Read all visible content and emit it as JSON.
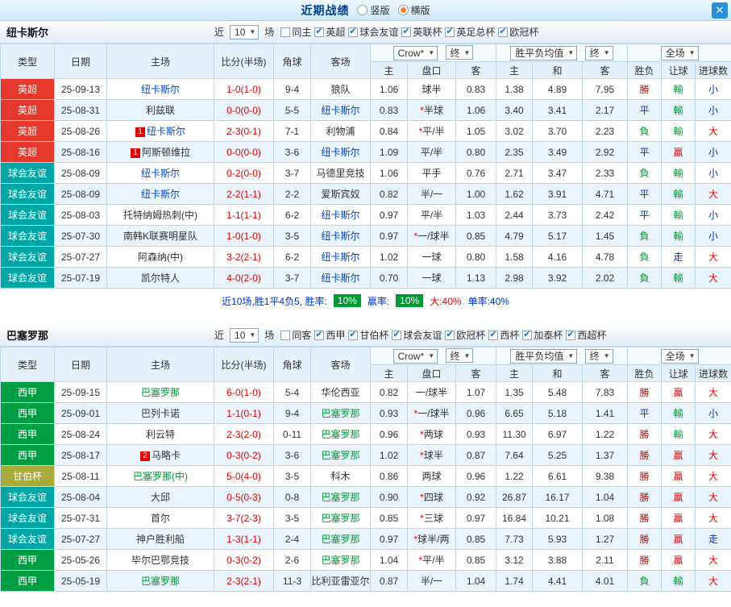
{
  "topbar": {
    "title": "近期战绩",
    "layout_options": [
      {
        "label": "竖版",
        "selected": false
      },
      {
        "label": "横版",
        "selected": true
      }
    ],
    "close_icon": "✕"
  },
  "type_colors": {
    "英超": "#e6392e",
    "球会友谊": "#00a6a6",
    "西甲": "#009e44",
    "甘伯杯": "#a8aa3c"
  },
  "result_colors": {
    "勝": "#e60000",
    "贏": "#e60000",
    "大": "#e60000",
    "平": "#0033cc",
    "走": "#0033cc",
    "小": "#0033cc",
    "負": "#009933",
    "輸": "#009933"
  },
  "sections": [
    {
      "team": "纽卡斯尔",
      "focal_color": "#0044cc",
      "near_label": "近",
      "near_count": "10",
      "near_suffix": "场",
      "filters": [
        {
          "label": "同主",
          "checked": false
        },
        {
          "label": "英超",
          "checked": true
        },
        {
          "label": "球会友谊",
          "checked": true
        },
        {
          "label": "英联杯",
          "checked": true
        },
        {
          "label": "英足总杯",
          "checked": true
        },
        {
          "label": "欧冠杯",
          "checked": true
        }
      ],
      "columns": {
        "type": "类型",
        "date": "日期",
        "home": "主场",
        "score": "比分(半场)",
        "corner": "角球",
        "away": "客场"
      },
      "odds_select": "Crow*",
      "odds_final": "终",
      "avg_select": "胜平负均值",
      "avg_final": "终",
      "scope_select": "全场",
      "sub_headers": [
        "主",
        "盘口",
        "客",
        "主",
        "和",
        "客",
        "胜负",
        "让球",
        "进球数"
      ],
      "rows": [
        {
          "type": "英超",
          "date": "25-09-13",
          "home": "纽卡斯尔",
          "home_focal": true,
          "home_badge": "",
          "score": "1-0(1-0)",
          "corner": "9-4",
          "away": "狼队",
          "away_focal": false,
          "away_badge": "",
          "odds_home": "1.06",
          "handicap": "球半",
          "odds_away": "0.83",
          "avg_home": "1.38",
          "avg_draw": "4.89",
          "avg_away": "7.95",
          "res_outcome": "勝",
          "res_handicap": "輸",
          "res_goals": "小"
        },
        {
          "type": "英超",
          "date": "25-08-31",
          "home": "利兹联",
          "home_focal": false,
          "home_badge": "",
          "score": "0-0(0-0)",
          "corner": "5-5",
          "away": "纽卡斯尔",
          "away_focal": true,
          "away_badge": "",
          "odds_home": "0.83",
          "handicap": "*半球",
          "odds_away": "1.06",
          "avg_home": "3.40",
          "avg_draw": "3.41",
          "avg_away": "2.17",
          "res_outcome": "平",
          "res_handicap": "輸",
          "res_goals": "小"
        },
        {
          "type": "英超",
          "date": "25-08-26",
          "home": "纽卡斯尔",
          "home_focal": true,
          "home_badge": "1",
          "score": "2-3(0-1)",
          "corner": "7-1",
          "away": "利物浦",
          "away_focal": false,
          "away_badge": "",
          "odds_home": "0.84",
          "handicap": "*平/半",
          "odds_away": "1.05",
          "avg_home": "3.02",
          "avg_draw": "3.70",
          "avg_away": "2.23",
          "res_outcome": "負",
          "res_handicap": "輸",
          "res_goals": "大"
        },
        {
          "type": "英超",
          "date": "25-08-16",
          "home": "阿斯顿维拉",
          "home_focal": false,
          "home_badge": "1",
          "score": "0-0(0-0)",
          "corner": "3-6",
          "away": "纽卡斯尔",
          "away_focal": true,
          "away_badge": "",
          "odds_home": "1.09",
          "handicap": "平/半",
          "odds_away": "0.80",
          "avg_home": "2.35",
          "avg_draw": "3.49",
          "avg_away": "2.92",
          "res_outcome": "平",
          "res_handicap": "贏",
          "res_goals": "小"
        },
        {
          "type": "球会友谊",
          "date": "25-08-09",
          "home": "纽卡斯尔",
          "home_focal": true,
          "home_badge": "",
          "score": "0-2(0-0)",
          "corner": "3-7",
          "away": "马德里竞技",
          "away_focal": false,
          "away_badge": "",
          "odds_home": "1.06",
          "handicap": "平手",
          "odds_away": "0.76",
          "avg_home": "2.71",
          "avg_draw": "3.47",
          "avg_away": "2.33",
          "res_outcome": "負",
          "res_handicap": "輸",
          "res_goals": "小"
        },
        {
          "type": "球会友谊",
          "date": "25-08-09",
          "home": "纽卡斯尔",
          "home_focal": true,
          "home_badge": "",
          "score": "2-2(1-1)",
          "corner": "2-2",
          "away": "爱斯宾奴",
          "away_focal": false,
          "away_badge": "",
          "odds_home": "0.82",
          "handicap": "半/一",
          "odds_away": "1.00",
          "avg_home": "1.62",
          "avg_draw": "3.91",
          "avg_away": "4.71",
          "res_outcome": "平",
          "res_handicap": "輸",
          "res_goals": "大"
        },
        {
          "type": "球会友谊",
          "date": "25-08-03",
          "home": "托特纳姆热刺(中)",
          "home_focal": false,
          "home_badge": "",
          "score": "1-1(1-1)",
          "corner": "6-2",
          "away": "纽卡斯尔",
          "away_focal": true,
          "away_badge": "",
          "odds_home": "0.97",
          "handicap": "平/半",
          "odds_away": "1.03",
          "avg_home": "2.44",
          "avg_draw": "3.73",
          "avg_away": "2.42",
          "res_outcome": "平",
          "res_handicap": "輸",
          "res_goals": "小"
        },
        {
          "type": "球会友谊",
          "date": "25-07-30",
          "home": "南韩K联赛明星队",
          "home_focal": false,
          "home_badge": "",
          "score": "1-0(1-0)",
          "corner": "3-5",
          "away": "纽卡斯尔",
          "away_focal": true,
          "away_badge": "",
          "odds_home": "0.97",
          "handicap": "*一/球半",
          "odds_away": "0.85",
          "avg_home": "4.79",
          "avg_draw": "5.17",
          "avg_away": "1.45",
          "res_outcome": "負",
          "res_handicap": "輸",
          "res_goals": "小"
        },
        {
          "type": "球会友谊",
          "date": "25-07-27",
          "home": "阿森纳(中)",
          "home_focal": false,
          "home_badge": "",
          "score": "3-2(2-1)",
          "corner": "6-2",
          "away": "纽卡斯尔",
          "away_focal": true,
          "away_badge": "",
          "odds_home": "1.02",
          "handicap": "一球",
          "odds_away": "0.80",
          "avg_home": "1.58",
          "avg_draw": "4.16",
          "avg_away": "4.78",
          "res_outcome": "負",
          "res_handicap": "走",
          "res_goals": "大"
        },
        {
          "type": "球会友谊",
          "date": "25-07-19",
          "home": "凯尔特人",
          "home_focal": false,
          "home_badge": "",
          "score": "4-0(2-0)",
          "corner": "3-7",
          "away": "纽卡斯尔",
          "away_focal": true,
          "away_badge": "",
          "odds_home": "0.70",
          "handicap": "一球",
          "odds_away": "1.13",
          "avg_home": "2.98",
          "avg_draw": "3.92",
          "avg_away": "2.02",
          "res_outcome": "負",
          "res_handicap": "輸",
          "res_goals": "大"
        }
      ],
      "summary": {
        "lead": "近10场,胜1平4负5, 胜率:",
        "win_rate": "10%",
        "mid": "赢率:",
        "odds_rate": "10%",
        "big": "大:40%",
        "single": "单率:40%"
      }
    },
    {
      "team": "巴塞罗那",
      "focal_color": "#009933",
      "near_label": "近",
      "near_count": "10",
      "near_suffix": "场",
      "filters": [
        {
          "label": "同客",
          "checked": false
        },
        {
          "label": "西甲",
          "checked": true
        },
        {
          "label": "甘伯杯",
          "checked": true
        },
        {
          "label": "球会友谊",
          "checked": true
        },
        {
          "label": "欧冠杯",
          "checked": true
        },
        {
          "label": "西杯",
          "checked": true
        },
        {
          "label": "加泰杯",
          "checked": true
        },
        {
          "label": "西超杯",
          "checked": true
        }
      ],
      "columns": {
        "type": "类型",
        "date": "日期",
        "home": "主场",
        "score": "比分(半场)",
        "corner": "角球",
        "away": "客场"
      },
      "odds_select": "Crow*",
      "odds_final": "终",
      "avg_select": "胜平负均值",
      "avg_final": "终",
      "scope_select": "全场",
      "sub_headers": [
        "主",
        "盘口",
        "客",
        "主",
        "和",
        "客",
        "胜负",
        "让球",
        "进球数"
      ],
      "rows": [
        {
          "type": "西甲",
          "date": "25-09-15",
          "home": "巴塞罗那",
          "home_focal": true,
          "home_badge": "",
          "score": "6-0(1-0)",
          "corner": "5-4",
          "away": "华伦西亚",
          "away_focal": false,
          "away_badge": "",
          "odds_home": "0.82",
          "handicap": "一/球半",
          "odds_away": "1.07",
          "avg_home": "1.35",
          "avg_draw": "5.48",
          "avg_away": "7.83",
          "res_outcome": "勝",
          "res_handicap": "贏",
          "res_goals": "大"
        },
        {
          "type": "西甲",
          "date": "25-09-01",
          "home": "巴列卡诺",
          "home_focal": false,
          "home_badge": "",
          "score": "1-1(0-1)",
          "corner": "9-4",
          "away": "巴塞罗那",
          "away_focal": true,
          "away_badge": "",
          "odds_home": "0.93",
          "handicap": "*一/球半",
          "odds_away": "0.96",
          "avg_home": "6.65",
          "avg_draw": "5.18",
          "avg_away": "1.41",
          "res_outcome": "平",
          "res_handicap": "輸",
          "res_goals": "小"
        },
        {
          "type": "西甲",
          "date": "25-08-24",
          "home": "利云特",
          "home_focal": false,
          "home_badge": "",
          "score": "2-3(2-0)",
          "corner": "0-11",
          "away": "巴塞罗那",
          "away_focal": true,
          "away_badge": "",
          "odds_home": "0.96",
          "handicap": "*两球",
          "odds_away": "0.93",
          "avg_home": "11.30",
          "avg_draw": "6.97",
          "avg_away": "1.22",
          "res_outcome": "勝",
          "res_handicap": "輸",
          "res_goals": "大"
        },
        {
          "type": "西甲",
          "date": "25-08-17",
          "home": "马略卡",
          "home_focal": false,
          "home_badge": "2",
          "score": "0-3(0-2)",
          "corner": "3-6",
          "away": "巴塞罗那",
          "away_focal": true,
          "away_badge": "",
          "odds_home": "1.02",
          "handicap": "*球半",
          "odds_away": "0.87",
          "avg_home": "7.64",
          "avg_draw": "5.25",
          "avg_away": "1.37",
          "res_outcome": "勝",
          "res_handicap": "贏",
          "res_goals": "大"
        },
        {
          "type": "甘伯杯",
          "date": "25-08-11",
          "home": "巴塞罗那(中)",
          "home_focal": true,
          "home_badge": "",
          "score": "5-0(4-0)",
          "corner": "3-5",
          "away": "科木",
          "away_focal": false,
          "away_badge": "",
          "odds_home": "0.86",
          "handicap": "两球",
          "odds_away": "0.96",
          "avg_home": "1.22",
          "avg_draw": "6.61",
          "avg_away": "9.38",
          "res_outcome": "勝",
          "res_handicap": "贏",
          "res_goals": "大"
        },
        {
          "type": "球会友谊",
          "date": "25-08-04",
          "home": "大邱",
          "home_focal": false,
          "home_badge": "",
          "score": "0-5(0-3)",
          "corner": "0-8",
          "away": "巴塞罗那",
          "away_focal": true,
          "away_badge": "",
          "odds_home": "0.90",
          "handicap": "*四球",
          "odds_away": "0.92",
          "avg_home": "26.87",
          "avg_draw": "16.17",
          "avg_away": "1.04",
          "res_outcome": "勝",
          "res_handicap": "贏",
          "res_goals": "大"
        },
        {
          "type": "球会友谊",
          "date": "25-07-31",
          "home": "首尔",
          "home_focal": false,
          "home_badge": "",
          "score": "3-7(2-3)",
          "corner": "3-5",
          "away": "巴塞罗那",
          "away_focal": true,
          "away_badge": "",
          "odds_home": "0.85",
          "handicap": "*三球",
          "odds_away": "0.97",
          "avg_home": "16.84",
          "avg_draw": "10.21",
          "avg_away": "1.08",
          "res_outcome": "勝",
          "res_handicap": "贏",
          "res_goals": "大"
        },
        {
          "type": "球会友谊",
          "date": "25-07-27",
          "home": "神户胜利船",
          "home_focal": false,
          "home_badge": "",
          "score": "1-3(1-1)",
          "corner": "2-4",
          "away": "巴塞罗那",
          "away_focal": true,
          "away_badge": "",
          "odds_home": "0.97",
          "handicap": "*球半/两",
          "odds_away": "0.85",
          "avg_home": "7.73",
          "avg_draw": "5.93",
          "avg_away": "1.27",
          "res_outcome": "勝",
          "res_handicap": "贏",
          "res_goals": "走"
        },
        {
          "type": "西甲",
          "date": "25-05-26",
          "home": "毕尔巴鄂竞技",
          "home_focal": false,
          "home_badge": "",
          "score": "0-3(0-2)",
          "corner": "2-6",
          "away": "巴塞罗那",
          "away_focal": true,
          "away_badge": "",
          "odds_home": "1.04",
          "handicap": "*平/半",
          "odds_away": "0.85",
          "avg_home": "3.12",
          "avg_draw": "3.88",
          "avg_away": "2.11",
          "res_outcome": "勝",
          "res_handicap": "贏",
          "res_goals": "大"
        },
        {
          "type": "西甲",
          "date": "25-05-19",
          "home": "巴塞罗那",
          "home_focal": true,
          "home_badge": "",
          "score": "2-3(2-1)",
          "corner": "11-3",
          "away": "比利亚雷亚尔",
          "away_focal": false,
          "away_badge": "",
          "odds_home": "0.87",
          "handicap": "半/一",
          "odds_away": "1.04",
          "avg_home": "1.74",
          "avg_draw": "4.41",
          "avg_away": "4.01",
          "res_outcome": "負",
          "res_handicap": "輸",
          "res_goals": "大"
        }
      ],
      "summary": null
    }
  ]
}
